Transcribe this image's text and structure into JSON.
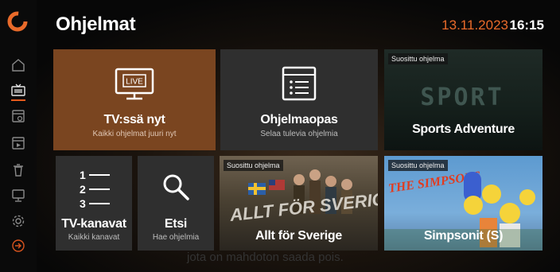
{
  "header": {
    "title": "Ohjelmat",
    "date": "13.11.2023",
    "time": "16:15"
  },
  "colors": {
    "accent": "#e86a2a",
    "highlight_tile": "#7a4520",
    "tile_dark": "#2f2f2f"
  },
  "sidebar": {
    "items": [
      {
        "name": "home-icon"
      },
      {
        "name": "tv-icon",
        "active": true
      },
      {
        "name": "recordings-icon"
      },
      {
        "name": "video-library-icon"
      },
      {
        "name": "trash-icon"
      },
      {
        "name": "monitor-icon"
      },
      {
        "name": "settings-icon"
      },
      {
        "name": "exit-icon"
      }
    ]
  },
  "tiles": {
    "live_tv": {
      "icon_text": "LIVE",
      "label": "TV:ssä nyt",
      "sub": "Kaikki ohjelmat juuri nyt"
    },
    "guide": {
      "label": "Ohjelmaopas",
      "sub": "Selaa tulevia ohjelmia"
    },
    "sports": {
      "badge": "Suosittu ohjelma",
      "art_text": "SPORT",
      "label": "Sports Adventure"
    },
    "channels": {
      "icon_digits": [
        "1",
        "2",
        "3"
      ],
      "label": "TV-kanavat",
      "sub": "Kaikki kanavat"
    },
    "search": {
      "label": "Etsi",
      "sub": "Hae ohjelmia"
    },
    "allt": {
      "badge": "Suosittu ohjelma",
      "art_text": "ALLT FÖR SVERIGE",
      "label": "Allt för Sverige"
    },
    "simpsons": {
      "badge": "Suosittu ohjelma",
      "art_text": "THE SIMPSONS",
      "label": "Simpsonit (S)"
    }
  },
  "background_subtitle": "jota on mahdoton saada pois."
}
